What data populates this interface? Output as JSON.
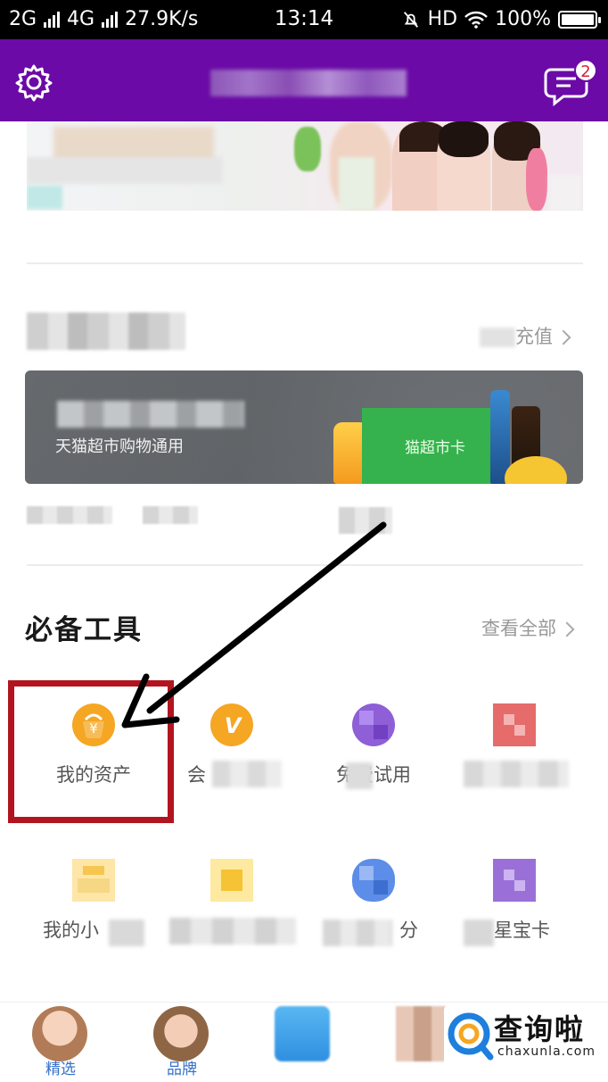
{
  "status_bar": {
    "network1": "2G",
    "network2": "4G",
    "speed": "27.9K/s",
    "time": "13:14",
    "hd": "HD",
    "battery": "100%"
  },
  "header": {
    "badge_count": "2",
    "accent": "#6b0aa6"
  },
  "tmall_section": {
    "recharge_link": "充值",
    "promo_subtitle": "天猫超市购物通用",
    "promo_card_label": "猫超市卡"
  },
  "tools_section": {
    "title": "必备工具",
    "view_all": "查看全部",
    "row1": [
      {
        "label": "我的资产",
        "icon": "money-bag-icon",
        "color": "#f5a623"
      },
      {
        "label": "会",
        "icon": "v-badge-icon",
        "color": "#f5a623"
      },
      {
        "label": "免费试用",
        "icon": "trial-icon",
        "color": "#8e5fd6"
      },
      {
        "label": "",
        "icon": "gift-icon",
        "color": "#e66b6b"
      }
    ],
    "row2": [
      {
        "label": "我的小",
        "icon": "shop-icon",
        "color": "#f6c650"
      },
      {
        "label": "机票",
        "icon": "ticket-icon",
        "color": "#f5c333"
      },
      {
        "label": "分",
        "icon": "points-icon",
        "color": "#5c8de8"
      },
      {
        "label": "星宝卡",
        "icon": "card-icon",
        "color": "#9a70d8"
      }
    ]
  },
  "tab_bar": {
    "tabs": [
      {
        "label": "精选"
      },
      {
        "label": "品牌"
      },
      {
        "label": ""
      },
      {
        "label": ""
      },
      {
        "label": ""
      }
    ]
  },
  "watermark": {
    "text": "查询啦",
    "sub": "chaxunla.com"
  }
}
